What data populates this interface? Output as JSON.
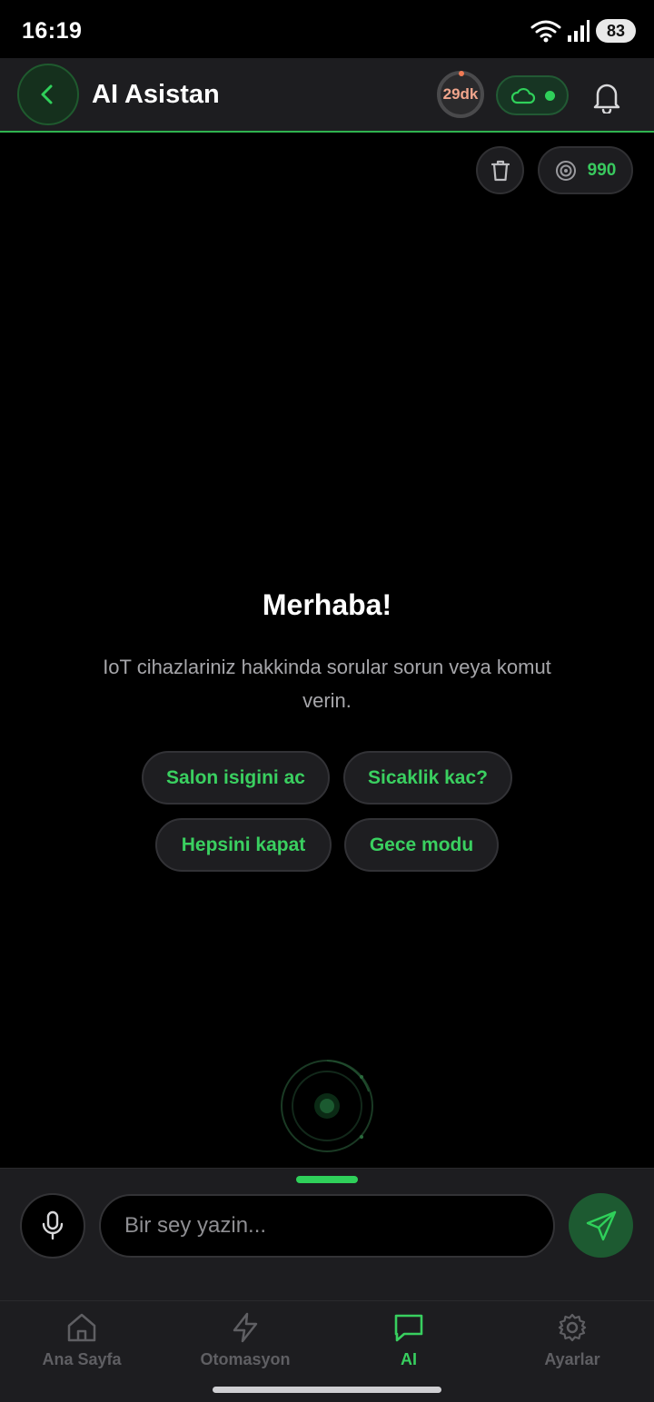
{
  "status_bar": {
    "time": "16:19",
    "battery": "83"
  },
  "header": {
    "title": "AI Asistan",
    "timer": "29dk"
  },
  "credits": {
    "value": "990"
  },
  "welcome": {
    "title": "Merhaba!",
    "text": "IoT cihazlariniz hakkinda sorular sorun veya komut verin."
  },
  "suggestions": [
    "Salon isigini ac",
    "Sicaklik kac?",
    "Hepsini kapat",
    "Gece modu"
  ],
  "input": {
    "placeholder": "Bir sey yazin..."
  },
  "nav": {
    "items": [
      {
        "label": "Ana Sayfa"
      },
      {
        "label": "Otomasyon"
      },
      {
        "label": "AI"
      },
      {
        "label": "Ayarlar"
      }
    ]
  },
  "colors": {
    "accent": "#2fd05a",
    "background": "#000000",
    "surface": "#1d1d20",
    "timer": "#f0a58c"
  }
}
